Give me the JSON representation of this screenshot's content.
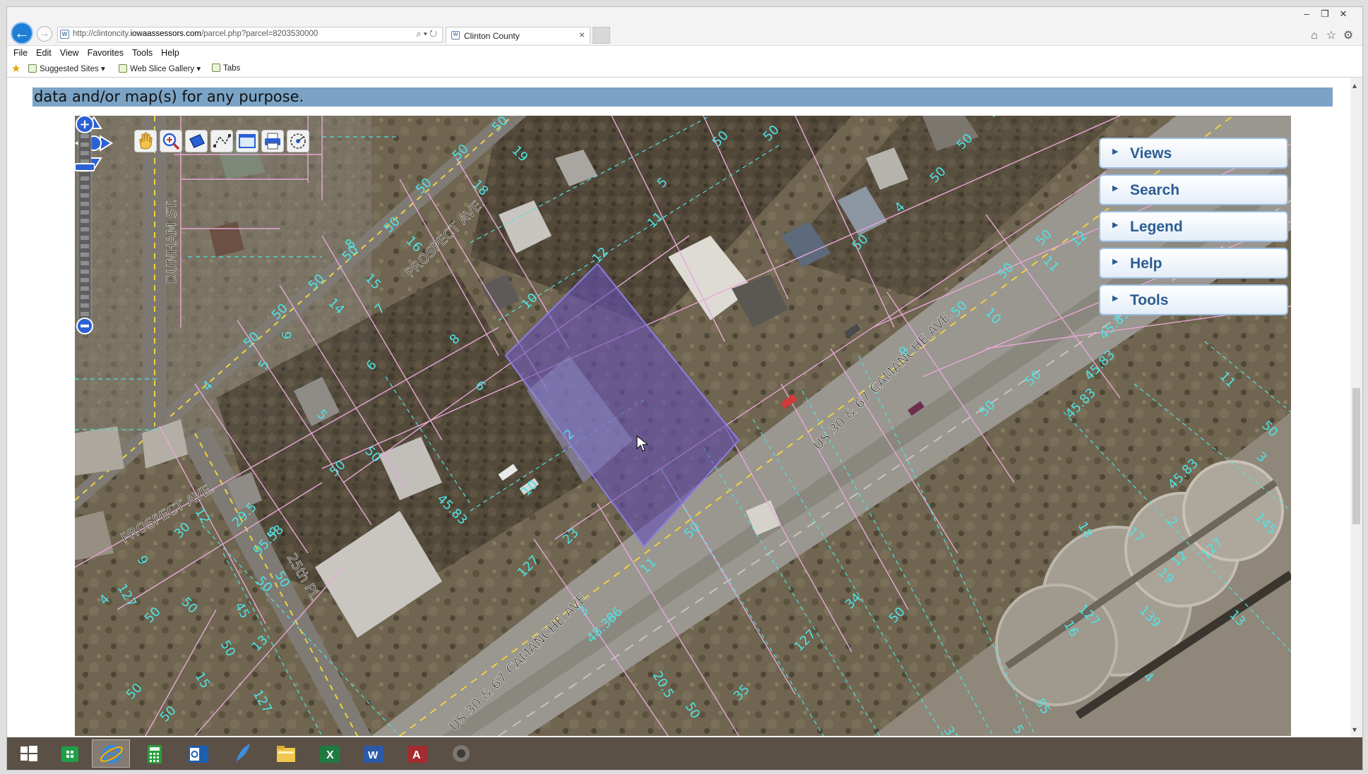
{
  "browser": {
    "url_prefix": "http://clintoncity.",
    "url_domain": "iowaassessors.com",
    "url_path": "/parcel.php?parcel=8203530000",
    "tab_title": "Clinton County",
    "tab_close": "×",
    "menu": [
      "File",
      "Edit",
      "View",
      "Favorites",
      "Tools",
      "Help"
    ],
    "favorites_bar": [
      "Suggested Sites ▾",
      "Web Slice Gallery ▾",
      "Tabs"
    ],
    "window_controls": [
      "–",
      "❐",
      "✕"
    ]
  },
  "page": {
    "disclaimer_text": "data and/or map(s) for any purpose."
  },
  "map": {
    "panels": [
      "Views",
      "Search",
      "Legend",
      "Help",
      "Tools"
    ],
    "streets": {
      "prospect_upper": "PROSPECT AVE.",
      "prospect_lower": "PROSPECT AVE.",
      "dunham": "DUNHAM ST.",
      "us30_upper": "US 30 & 67 CAMANCHE AVE.",
      "us30_lower": "US 30 & 67 CAMANCHE AVE.",
      "twentyfifth": "25th PL"
    },
    "dimension_labels": [
      "50",
      "19",
      "50",
      "18",
      "50",
      "50",
      "16",
      "50",
      "15",
      "50",
      "14",
      "50",
      "6",
      "50",
      "5",
      "4",
      "50",
      "12",
      "11",
      "10",
      "8",
      "6",
      "5",
      "50",
      "50",
      "50",
      "50",
      "4",
      "50",
      "50",
      "50",
      "50",
      "9",
      "50",
      "10",
      "50",
      "11",
      "50",
      "12",
      "50",
      "50",
      "45.83",
      "45.83",
      "45.83",
      "45.83",
      "19",
      "139",
      "18",
      "17",
      "16",
      "85",
      "50",
      "145",
      "11",
      "12",
      "13",
      "127",
      "2",
      "3",
      "127",
      "4",
      "5",
      "33",
      "50",
      "34",
      "127",
      "35",
      "50",
      "20.5",
      "48.33",
      "23",
      "127",
      "3",
      "2",
      "10",
      "11",
      "66",
      "50",
      "29.5",
      "9",
      "95.58",
      "50",
      "45",
      "50",
      "50",
      "50",
      "50",
      "4",
      "127",
      "30",
      "12",
      "13",
      "127",
      "15",
      "50",
      "50",
      "9",
      "8",
      "7",
      "6",
      "5",
      "50",
      "50",
      "45.83"
    ]
  },
  "colors": {
    "accent_blue": "#2c5d92",
    "selected_parcel": "#6450b4",
    "parcel_line": "#e8a8d8",
    "dim_text": "#4fe3e3",
    "road_center": "#f0d23c"
  }
}
